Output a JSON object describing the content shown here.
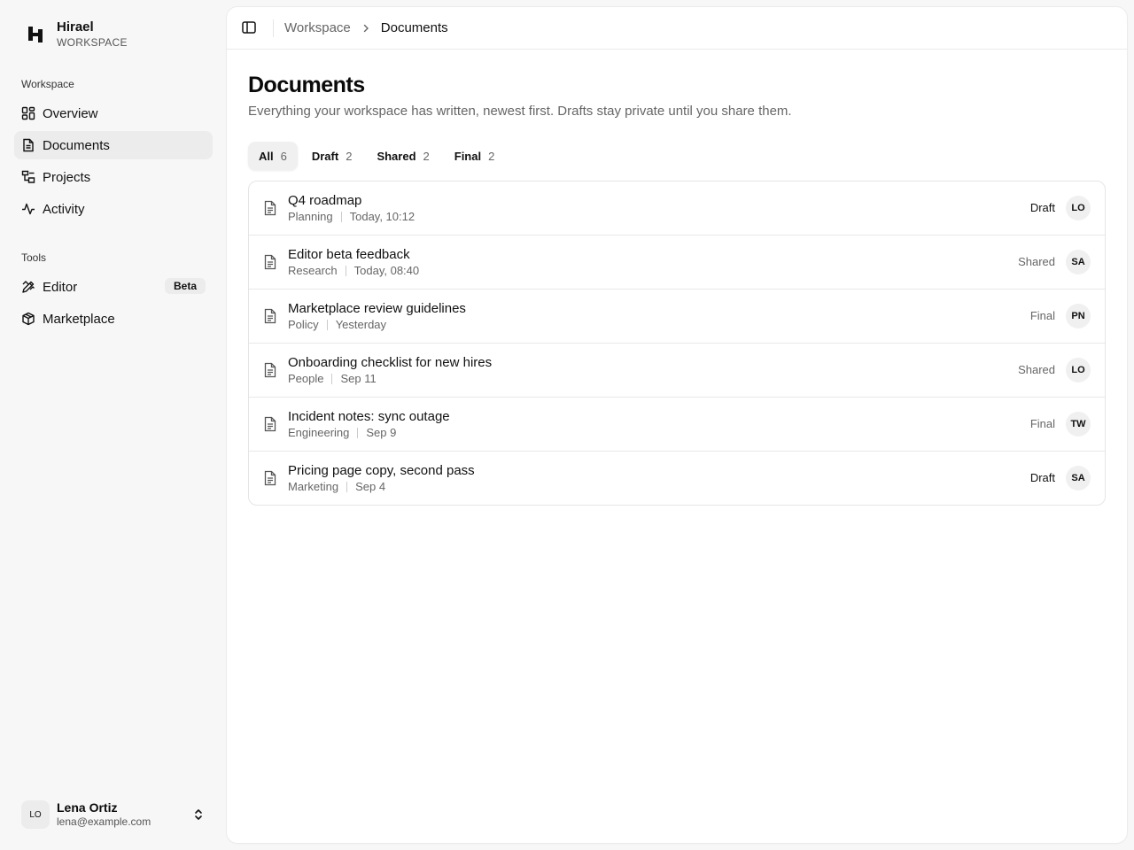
{
  "brand": {
    "name": "Hirael",
    "subtitle": "WORKSPACE"
  },
  "sidebar": {
    "sections": [
      {
        "title": "Workspace",
        "items": [
          {
            "label": "Overview",
            "icon": "dashboard-icon"
          },
          {
            "label": "Documents",
            "icon": "document-icon",
            "active": true
          },
          {
            "label": "Projects",
            "icon": "folder-tree-icon"
          },
          {
            "label": "Activity",
            "icon": "activity-icon"
          }
        ]
      },
      {
        "title": "Tools",
        "items": [
          {
            "label": "Editor",
            "icon": "pen-ruler-icon",
            "badge": "Beta"
          },
          {
            "label": "Marketplace",
            "icon": "package-icon"
          }
        ]
      }
    ]
  },
  "user": {
    "initials": "LO",
    "name": "Lena Ortiz",
    "email": "lena@example.com"
  },
  "breadcrumb": {
    "parent": "Workspace",
    "current": "Documents"
  },
  "page": {
    "title": "Documents",
    "description": "Everything your workspace has written, newest first. Drafts stay private until you share them."
  },
  "tabs": [
    {
      "label": "All",
      "count": "6",
      "active": true
    },
    {
      "label": "Draft",
      "count": "2"
    },
    {
      "label": "Shared",
      "count": "2"
    },
    {
      "label": "Final",
      "count": "2"
    }
  ],
  "documents": [
    {
      "title": "Q4 roadmap",
      "category": "Planning",
      "date": "Today, 10:12",
      "status": "Draft",
      "owner": "LO"
    },
    {
      "title": "Editor beta feedback",
      "category": "Research",
      "date": "Today, 08:40",
      "status": "Shared",
      "owner": "SA"
    },
    {
      "title": "Marketplace review guidelines",
      "category": "Policy",
      "date": "Yesterday",
      "status": "Final",
      "owner": "PN"
    },
    {
      "title": "Onboarding checklist for new hires",
      "category": "People",
      "date": "Sep 11",
      "status": "Shared",
      "owner": "LO"
    },
    {
      "title": "Incident notes: sync outage",
      "category": "Engineering",
      "date": "Sep 9",
      "status": "Final",
      "owner": "TW"
    },
    {
      "title": "Pricing page copy, second pass",
      "category": "Marketing",
      "date": "Sep 4",
      "status": "Draft",
      "owner": "SA"
    }
  ]
}
